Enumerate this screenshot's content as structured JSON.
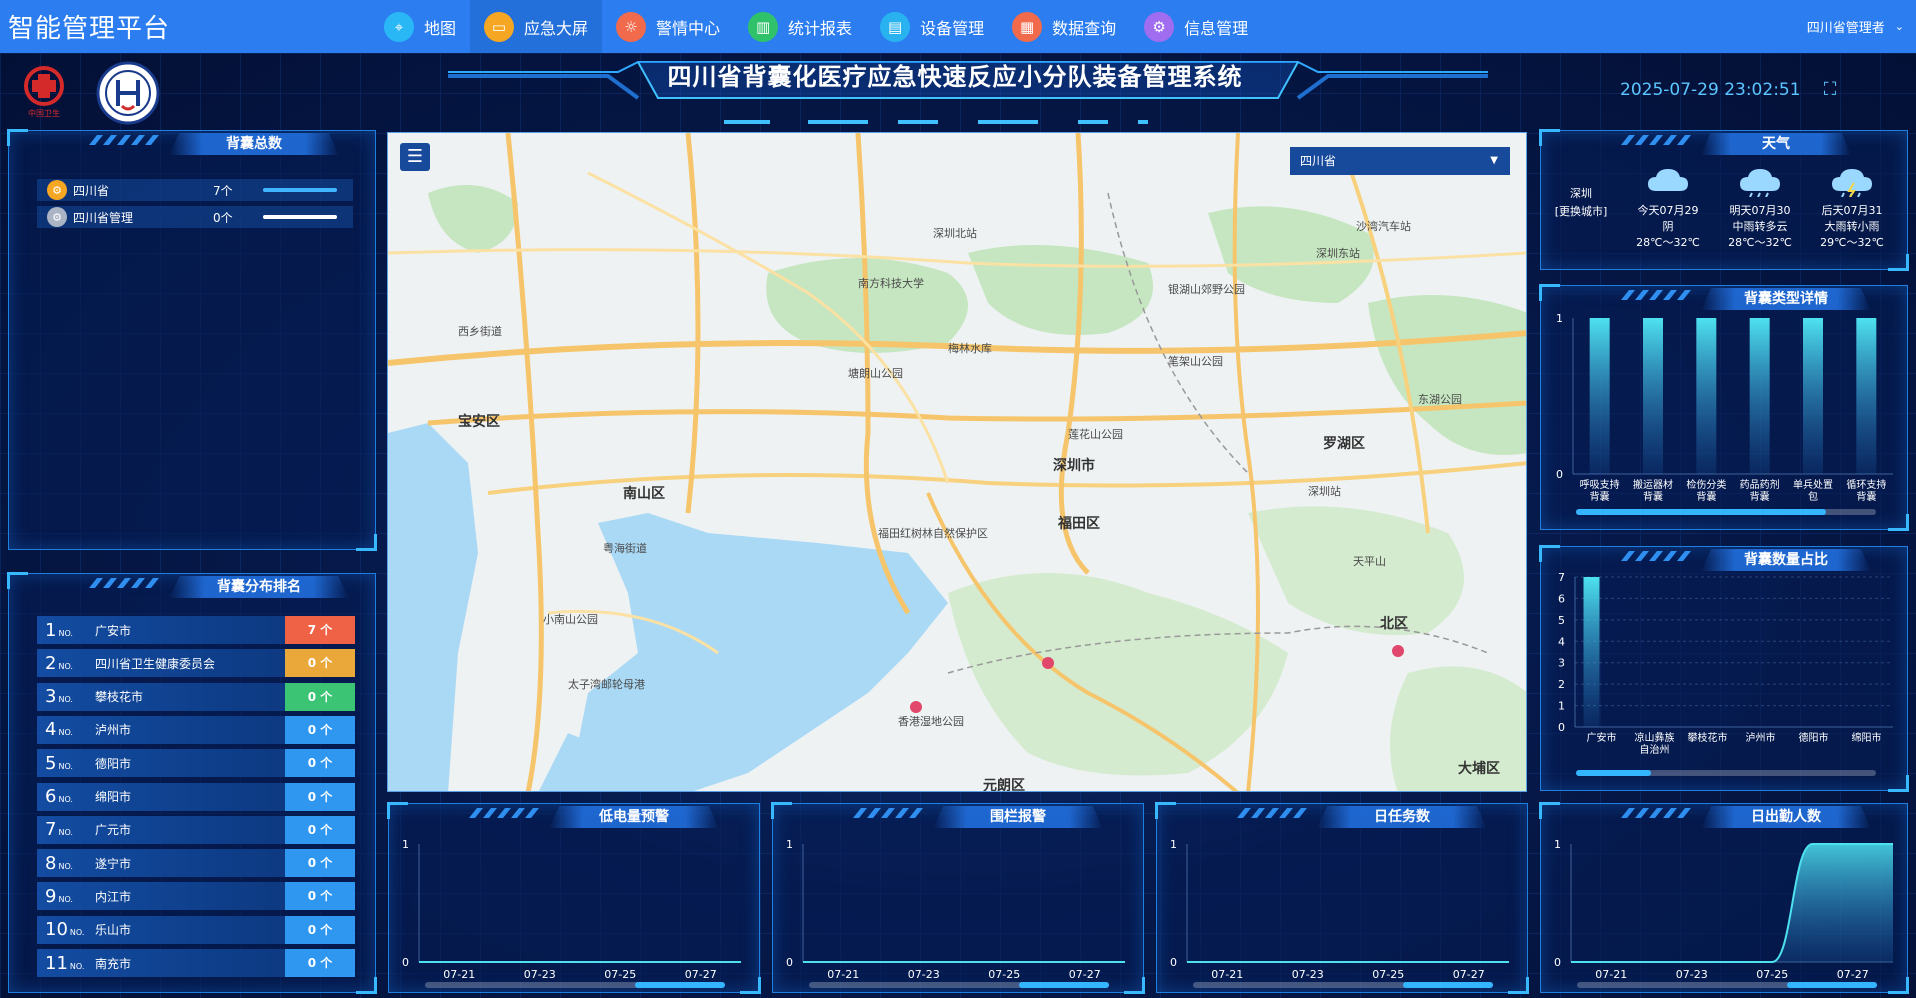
{
  "nav": {
    "brand": "智能管理平台",
    "items": [
      {
        "label": "地图",
        "icon": "map-pin-icon",
        "color": "#2ab7f5",
        "glyph": "⌖",
        "active": false
      },
      {
        "label": "应急大屏",
        "icon": "monitor-icon",
        "color": "#f5a623",
        "glyph": "▭",
        "active": true
      },
      {
        "label": "警情中心",
        "icon": "alarm-icon",
        "color": "#f06a4b",
        "glyph": "☼",
        "active": false
      },
      {
        "label": "统计报表",
        "icon": "bar-chart-icon",
        "color": "#2fc26b",
        "glyph": "▥",
        "active": false
      },
      {
        "label": "设备管理",
        "icon": "document-icon",
        "color": "#28b3f0",
        "glyph": "▤",
        "active": false
      },
      {
        "label": "数据查询",
        "icon": "grid-icon",
        "color": "#f06a4b",
        "glyph": "▦",
        "active": false
      },
      {
        "label": "信息管理",
        "icon": "gear-icon",
        "color": "#a06cf0",
        "glyph": "⚙",
        "active": false
      }
    ],
    "user": "四川省管理者"
  },
  "header": {
    "title": "四川省背囊化医疗应急快速反应小分队装备管理系统",
    "datetime": "2025-07-29 23:02:51",
    "logo_text": "中国卫生"
  },
  "total": {
    "title": "背囊总数",
    "rows": [
      {
        "name": "四川省",
        "count": "7个",
        "fill": 1.0,
        "color": "#3fb6ff",
        "icon_color": "#f5a623"
      },
      {
        "name": "四川省管理",
        "count": "0个",
        "fill": 1.0,
        "color": "#ffffff",
        "icon_color": "#aab4c4"
      }
    ]
  },
  "ranking": {
    "title": "背囊分布排名",
    "suffix": "NO.",
    "rows": [
      {
        "no": "1",
        "name": "广安市",
        "value": "7 个",
        "color": "#f06245"
      },
      {
        "no": "2",
        "name": "四川省卫生健康委员会",
        "value": "0 个",
        "color": "#eaa83a"
      },
      {
        "no": "3",
        "name": "攀枝花市",
        "value": "0 个",
        "color": "#3bc474"
      },
      {
        "no": "4",
        "name": "泸州市",
        "value": "0 个",
        "color": "#2f97f0"
      },
      {
        "no": "5",
        "name": "德阳市",
        "value": "0 个",
        "color": "#2f97f0"
      },
      {
        "no": "6",
        "name": "绵阳市",
        "value": "0 个",
        "color": "#2f97f0"
      },
      {
        "no": "7",
        "name": "广元市",
        "value": "0 个",
        "color": "#2f97f0"
      },
      {
        "no": "8",
        "name": "遂宁市",
        "value": "0 个",
        "color": "#2f97f0"
      },
      {
        "no": "9",
        "name": "内江市",
        "value": "0 个",
        "color": "#2f97f0"
      },
      {
        "no": "10",
        "name": "乐山市",
        "value": "0 个",
        "color": "#2f97f0"
      },
      {
        "no": "11",
        "name": "南充市",
        "value": "0 个",
        "color": "#2f97f0"
      }
    ]
  },
  "map": {
    "select_value": "四川省",
    "labels": {
      "shenzhen": "深圳市",
      "nanshan": "南山区",
      "futian": "福田区",
      "luohu": "罗湖区",
      "baoan": "宝安区",
      "dapeng": "大埔区",
      "beiqu": "北区",
      "yuanlang": "元朗区",
      "xixiang": "西乡街道",
      "yuehai": "粤海街道",
      "shekou": "太子湾邮轮母港",
      "wetland": "香港湿地公园",
      "futianlin": "福田红树林自然保护区",
      "tanglang": "塘朗山公园",
      "meilin": "梅林水库",
      "yinhu": "银湖山郊野公园",
      "shenzhenbei": "深圳北站",
      "shenzhenzhan": "深圳站",
      "shenzhendong": "深圳东站",
      "dameisha": "沙湾汽车站",
      "nanfang": "南方科技大学",
      "lianhua": "莲花山公园",
      "bijia": "笔架山公园",
      "dongmen": "东湖公园",
      "shawan": "天平山",
      "xiaonan": "小南山公园"
    }
  },
  "weather": {
    "title": "天气",
    "city": "深圳",
    "change_city": "[更换城市]",
    "days": [
      {
        "label": "今天07月29",
        "desc": "阴",
        "temp": "28℃～32℃",
        "icon": "cloud-icon"
      },
      {
        "label": "明天07月30",
        "desc": "中雨转多云",
        "temp": "28℃～32℃",
        "icon": "rain-cloud-icon"
      },
      {
        "label": "后天07月31",
        "desc": "大雨转小雨",
        "temp": "29℃～32℃",
        "icon": "storm-cloud-icon"
      }
    ]
  },
  "type_detail": {
    "title": "背囊类型详情",
    "chart_data": {
      "type": "bar",
      "categories": [
        [
          "呼吸支持",
          "背囊"
        ],
        [
          "搬运器材",
          "背囊"
        ],
        [
          "检伤分类",
          "背囊"
        ],
        [
          "药品药剂",
          "背囊"
        ],
        [
          "单兵处置",
          "包"
        ],
        [
          "循环支持",
          "背囊"
        ]
      ],
      "values": [
        1,
        1,
        1,
        1,
        1,
        1
      ],
      "ylim": [
        0,
        1
      ],
      "yticks": [
        "0",
        "1"
      ]
    }
  },
  "quantity": {
    "title": "背囊数量占比",
    "chart_data": {
      "type": "bar",
      "categories": [
        [
          "广安市"
        ],
        [
          "凉山彝族",
          "自治州"
        ],
        [
          "攀枝花市"
        ],
        [
          "泸州市"
        ],
        [
          "德阳市"
        ],
        [
          "绵阳市"
        ]
      ],
      "values": [
        7,
        0,
        0,
        0,
        0,
        0
      ],
      "ylim": [
        0,
        7
      ],
      "yticks": [
        "0",
        "1",
        "2",
        "3",
        "4",
        "5",
        "6",
        "7"
      ]
    }
  },
  "low_battery": {
    "title": "低电量预警",
    "chart_data": {
      "type": "line",
      "x": [
        "07-21",
        "07-23",
        "07-25",
        "07-27"
      ],
      "values": [
        0,
        0,
        0,
        0
      ],
      "ylim": [
        0,
        1
      ],
      "yticks": [
        "0",
        "1"
      ]
    }
  },
  "fence_alarm": {
    "title": "围栏报警",
    "chart_data": {
      "type": "line",
      "x": [
        "07-21",
        "07-23",
        "07-25",
        "07-27"
      ],
      "values": [
        0,
        0,
        0,
        0
      ],
      "ylim": [
        0,
        1
      ],
      "yticks": [
        "0",
        "1"
      ]
    }
  },
  "daily_tasks": {
    "title": "日任务数",
    "chart_data": {
      "type": "line",
      "x": [
        "07-21",
        "07-23",
        "07-25",
        "07-27"
      ],
      "values": [
        0,
        0,
        0,
        0
      ],
      "ylim": [
        0,
        1
      ],
      "yticks": [
        "0",
        "1"
      ]
    }
  },
  "daily_attendance": {
    "title": "日出勤人数",
    "chart_data": {
      "type": "area",
      "x": [
        "07-21",
        "07-23",
        "07-25",
        "07-27"
      ],
      "series_x": [
        "07-21",
        "07-22",
        "07-23",
        "07-24",
        "07-25",
        "07-26",
        "07-27",
        "07-28",
        "07-29"
      ],
      "values": [
        0,
        0,
        0,
        0,
        0,
        0,
        1,
        1,
        1
      ],
      "ylim": [
        0,
        1
      ],
      "yticks": [
        "0",
        "1"
      ]
    }
  }
}
